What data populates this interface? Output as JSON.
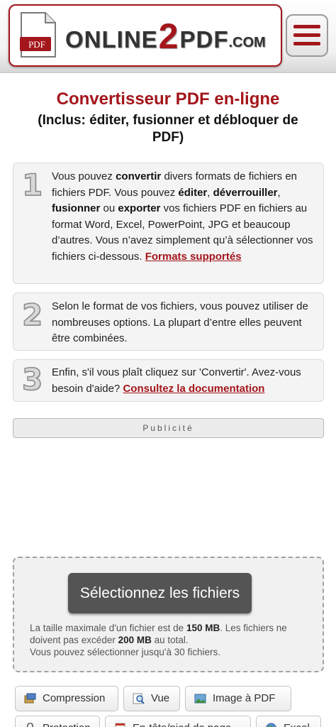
{
  "header": {
    "logo_badge": "PDF",
    "logo_word": "ONLINE",
    "logo_two": "2",
    "logo_pdf": "PDF",
    "logo_com": ".COM",
    "menu_icon": "hamburger-icon"
  },
  "title": "Convertisseur PDF en-ligne",
  "subtitle": "(Inclus: éditer, fusionner et débloquer de PDF)",
  "steps": [
    {
      "number": "1",
      "parts": {
        "t1": "Vous pouvez ",
        "b1": "convertir",
        "t2": " divers formats de fichiers en fichiers PDF. Vous pouvez ",
        "b2": "éditer",
        "t3": ", ",
        "b3": "déverrouiller",
        "t4": ", ",
        "b4": "fusionner",
        "t5": " ou ",
        "b5": "exporter",
        "t6": " vos fichiers PDF en fichiers au format Word, Excel, PowerPoint, JPG et beaucoup d’autres. Vous n’avez simplement qu’à sélectionner vos fichiers ci-dessous. ",
        "link": "Formats supportés"
      }
    },
    {
      "number": "2",
      "text": "Selon le format de vos fichiers, vous pouvez utiliser de nombreuses options. La plupart d’entre elles peuvent être combinées."
    },
    {
      "number": "3",
      "text": "Enfin, s'il vous plaît cliquez sur 'Convertir'. Avez-vous besoin d'aide? ",
      "link": "Consultez la documentation"
    }
  ],
  "pub_label": "Publicité",
  "upload": {
    "button": "Sélectionnez les fichiers",
    "info1": "La taille maximale d'un fichier est de ",
    "max_file": "150 MB",
    "info2": ". Les fichiers ne doivent pas excéder ",
    "max_total": "200 MB",
    "info3": " au total.",
    "info4": "Vous pouvez sélectionner jusqu'à 30 fichiers."
  },
  "tools": [
    {
      "label": "Compression",
      "icon": "compression-icon"
    },
    {
      "label": "Vue",
      "icon": "magnifier-icon"
    },
    {
      "label": "Image à PDF",
      "icon": "image-icon"
    },
    {
      "label": "Protection",
      "icon": "lock-icon"
    },
    {
      "label": "En-tête/pied de page",
      "icon": "document-icon"
    },
    {
      "label": "Excel",
      "icon": "globe-icon"
    }
  ],
  "colors": {
    "brand": "#a3161b",
    "button": "#545454"
  }
}
